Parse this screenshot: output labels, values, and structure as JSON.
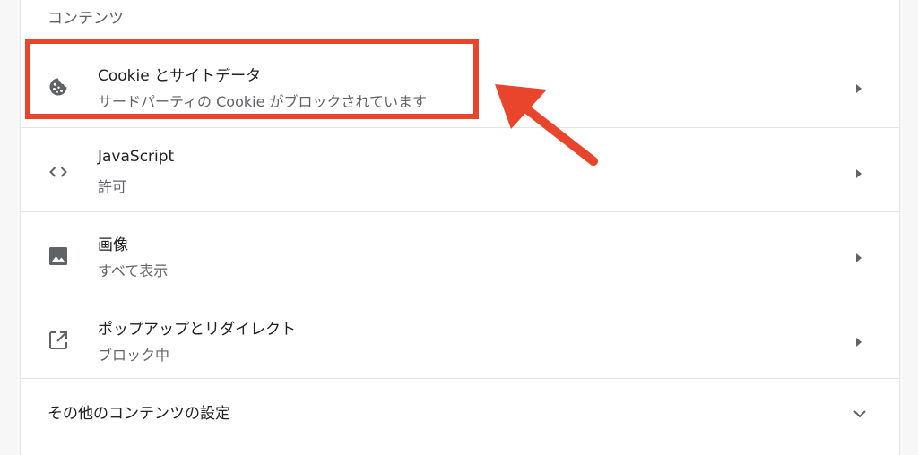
{
  "section": {
    "header": "コンテンツ"
  },
  "rows": [
    {
      "title": "Cookie とサイトデータ",
      "subtitle": "サードパーティの Cookie がブロックされています",
      "icon": "cookie-icon"
    },
    {
      "title": "JavaScript",
      "subtitle": "許可",
      "icon": "code-icon"
    },
    {
      "title": "画像",
      "subtitle": "すべて表示",
      "icon": "image-icon"
    },
    {
      "title": "ポップアップとリダイレクト",
      "subtitle": "ブロック中",
      "icon": "open-in-new-icon"
    }
  ],
  "more": {
    "label": "その他のコンテンツの設定",
    "icon": "chevron-down-icon"
  },
  "annotation": {
    "color": "#e8452c"
  }
}
